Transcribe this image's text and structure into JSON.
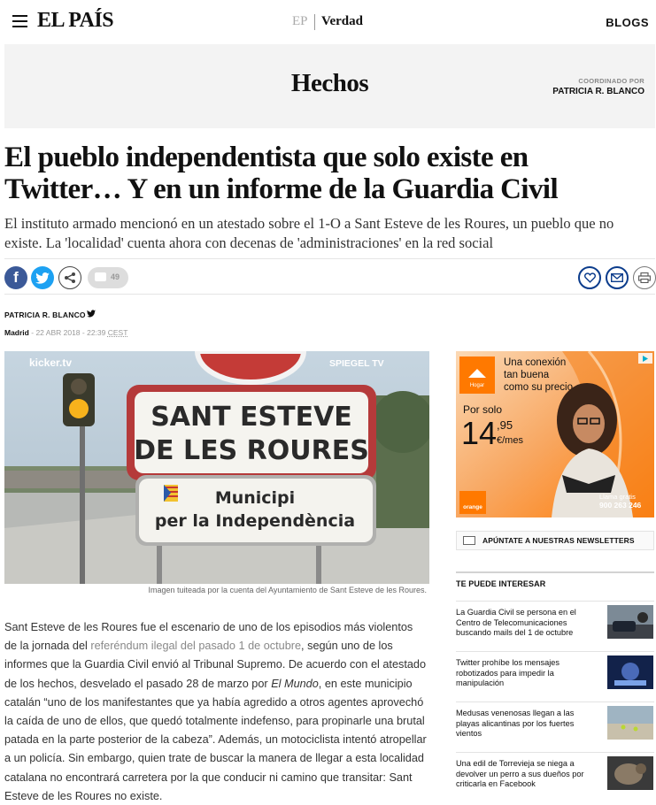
{
  "header": {
    "logo": "EL PAÍS",
    "section_prefix": "EP",
    "section": "Verdad",
    "blogs": "BLOGS"
  },
  "blog": {
    "name": "Hechos",
    "coord_label": "COORDINADO POR",
    "coord_name": "PATRICIA R. BLANCO"
  },
  "article": {
    "title": "El pueblo independentista que solo existe en Twitter… Y en un informe de la Guardia Civil",
    "subtitle": "El instituto armado mencionó en un atestado sobre el 1-O a Sant Esteve de les Roures, un pueblo que no existe. La 'localidad' cuenta ahora con decenas de 'administraciones' en la red social",
    "author": "PATRICIA R. BLANCO",
    "place": "Madrid",
    "date": "22 ABR 2018 - 22:39",
    "tz": "CEST",
    "comments": "49",
    "photo": {
      "sign_line1": "SANT ESTEVE",
      "sign_line2": "DE LES ROURES",
      "sign2_line1": "Municipi",
      "sign2_line2": "per la Independència",
      "watermark_left": "kicker.tv",
      "watermark_right": "SPIEGEL TV"
    },
    "caption": "Imagen tuiteada por la cuenta del Ayuntamiento de Sant Esteve de les Roures.",
    "body": {
      "p1": "Sant Esteve de les Roures fue el escenario de uno de los episodios más violentos de la jornada del ",
      "link": "referéndum ilegal del pasado 1 de octubre",
      "p2": ", según uno de los informes que la Guardia Civil envió al Tribunal Supremo. De acuerdo con el atestado de los hechos, desvelado el pasado 28 de marzo por ",
      "source": "El Mundo",
      "p3": ", en este municipio catalán “uno de los manifestantes que ya había agredido a otros agentes aprovechó la caída de uno de ellos, que quedó totalmente indefenso, para propinarle una brutal patada en la parte posterior de la cabeza”. Además, un motociclista intentó atropellar a un policía. Sin embargo, quien trate de buscar la manera de llegar a esta localidad catalana no encontrará carretera por la que conducir ni camino que transitar: Sant Esteve de les Roures no existe."
    }
  },
  "ad": {
    "line1": "Una conexión",
    "line2": "tan buena",
    "line3": "como su precio",
    "por_solo": "Por solo",
    "price_int": "14",
    "price_dec": ",95",
    "price_unit": "€/mes",
    "hogar": "Hogar",
    "brand": "orange",
    "call1": "Llama gratis",
    "call2": "900 263 246"
  },
  "sidebar": {
    "newsletter": "APÚNTATE A NUESTRAS NEWSLETTERS",
    "interest_title": "TE PUEDE INTERESAR",
    "related": [
      {
        "title": "La Guardia Civil se persona en el Centro de Telecomunicaciones buscando mails del 1 de octubre"
      },
      {
        "title": "Twitter prohíbe los mensajes robotizados para impedir la manipulación"
      },
      {
        "title": "Medusas venenosas llegan a las playas alicantinas por los fuertes vientos"
      },
      {
        "title": "Una edil de Torrevieja se niega a devolver un perro a sus dueños por criticarla en Facebook"
      }
    ]
  },
  "colors": {
    "facebook": "#3b5998",
    "twitter": "#1da1f2",
    "brand_blue": "#0b3c8c",
    "orange": "#ff7900"
  }
}
